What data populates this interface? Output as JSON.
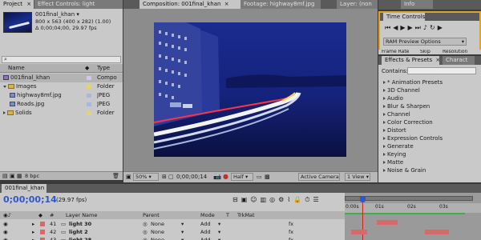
{
  "project": {
    "tab_label": "Project",
    "effect_controls_tab": "Effect Controls: light",
    "comp_name": "001final_khan",
    "comp_dims": "800 x 563 (400 x 282) (1.00)",
    "comp_duration": "Δ 0;00;04;00, 29.97 fps",
    "col_name": "Name",
    "col_type": "Type",
    "items": [
      {
        "name": "001final_khan",
        "type": "Compo",
        "kind": "comp",
        "indent": 0
      },
      {
        "name": "Images",
        "type": "Folder",
        "kind": "folder-open",
        "indent": 0
      },
      {
        "name": "highway8mf.jpg",
        "type": "JPEG",
        "kind": "image",
        "indent": 1
      },
      {
        "name": "Roads.jpg",
        "type": "JPEG",
        "kind": "image",
        "indent": 1
      },
      {
        "name": "Solids",
        "type": "Folder",
        "kind": "folder",
        "indent": 0
      }
    ],
    "bpc_label": "8 bpc"
  },
  "viewer": {
    "comp_tab": "Composition: 001final_khan",
    "footage_tab": "Footage: highway8mf.jpg",
    "layer_tab": "Layer: (non",
    "zoom": "50%",
    "timecode": "0;00;00;14",
    "resolution": "Half",
    "camera": "Active Camera",
    "views": "1 View"
  },
  "info": {
    "info_tab": "Info",
    "time_controls_tab": "Time Controls",
    "ram_preview": "RAM Preview Options",
    "frame_rate": "Frame Rate",
    "skip": "Skip",
    "resolution": "Resolution"
  },
  "effects": {
    "tab": "Effects & Presets",
    "char_tab": "Charact",
    "contains_label": "Contains:",
    "items": [
      "* Animation Presets",
      "3D Channel",
      "Audio",
      "Blur & Sharpen",
      "Channel",
      "Color Correction",
      "Distort",
      "Expression Controls",
      "Generate",
      "Keying",
      "Matte",
      "Noise & Grain"
    ]
  },
  "timeline": {
    "tab": "001final_khan",
    "timecode": "0;00;00;14",
    "fps": "(29.97 fps)",
    "headers": {
      "num": "#",
      "layer_name": "Layer Name",
      "parent": "Parent",
      "mode": "Mode",
      "t": "T",
      "trkmat": "TrkMat"
    },
    "rows": [
      {
        "num": "41",
        "name": "light 30",
        "parent": "None",
        "mode": "Add"
      },
      {
        "num": "42",
        "name": "light 2",
        "parent": "None",
        "mode": "Add"
      },
      {
        "num": "43",
        "name": "light 28",
        "parent": "None",
        "mode": "Add"
      }
    ],
    "ruler": [
      "0:00s",
      "01s",
      "02s",
      "03s"
    ]
  },
  "colors": {
    "accent_orange": "#e8a31e",
    "timecode_blue": "#3355cc",
    "layer_red": "#d46a6a",
    "playhead": "#cc2222"
  }
}
